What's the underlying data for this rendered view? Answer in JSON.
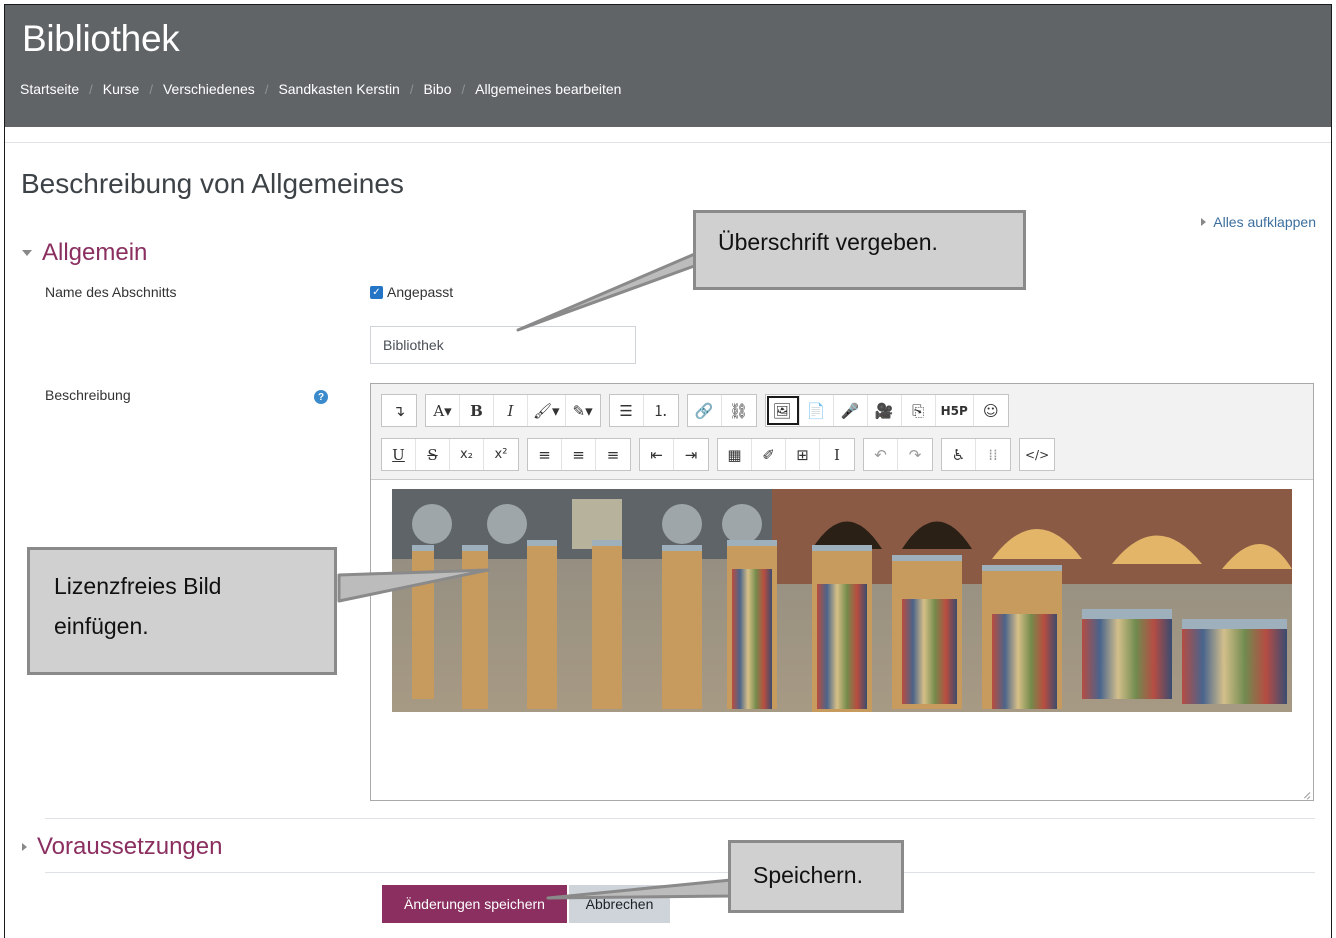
{
  "header": {
    "site_title": "Bibliothek",
    "breadcrumb": [
      "Startseite",
      "Kurse",
      "Verschiedenes",
      "Sandkasten Kerstin",
      "Bibo",
      "Allgemeines bearbeiten"
    ]
  },
  "page": {
    "title": "Beschreibung von Allgemeines",
    "expand_all": "Alles aufklappen"
  },
  "section_general": {
    "title": "Allgemein",
    "name_label": "Name des Abschnitts",
    "custom_checkbox_label": "Angepasst",
    "name_value": "Bibliothek",
    "description_label": "Beschreibung",
    "help_icon": "?"
  },
  "editor": {
    "row1": [
      [
        "↴"
      ],
      [
        "A▾",
        "B",
        "I",
        "🖌▾",
        "✎▾"
      ],
      [
        "☰",
        "⒈"
      ],
      [
        "🔗",
        "⛓"
      ],
      [
        "🖼",
        "📄",
        "🎤",
        "🎥",
        "⎘",
        "H5P",
        "☺"
      ]
    ],
    "row2": [
      [
        "U",
        "S",
        "x₂",
        "x²"
      ],
      [
        "≡",
        "≡",
        "≡"
      ],
      [
        "⇤",
        "⇥"
      ],
      [
        "▦",
        "✐",
        "⊞",
        "I"
      ],
      [
        "↶",
        "↷"
      ],
      [
        "♿",
        "⁞⁞"
      ],
      [
        "</>"
      ]
    ]
  },
  "section_prereq": {
    "title": "Voraussetzungen"
  },
  "actions": {
    "save": "Änderungen speichern",
    "cancel": "Abbrechen"
  },
  "callouts": {
    "heading": "Überschrift vergeben.",
    "image_line1": "Lizenzfreies Bild",
    "image_line2": "einfügen.",
    "save": "Speichern."
  }
}
